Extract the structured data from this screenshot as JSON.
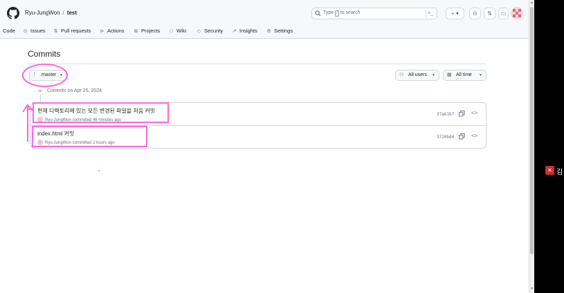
{
  "header": {
    "owner": "Ryu-JungWon",
    "separator": "/",
    "repo": "test",
    "search_placeholder_prefix": "Type",
    "search_key": "/",
    "search_placeholder_suffix": "to search",
    "command_glyph": ">_",
    "new_button": "+ ▾",
    "issues_icon": "⊙",
    "pr_icon": "⇅",
    "inbox_icon": "▭"
  },
  "nav": {
    "items": [
      {
        "label": "Code",
        "icon": "code-icon"
      },
      {
        "label": "Issues",
        "icon": "issue-icon"
      },
      {
        "label": "Pull requests",
        "icon": "pull-request-icon"
      },
      {
        "label": "Actions",
        "icon": "play-icon"
      },
      {
        "label": "Projects",
        "icon": "table-icon"
      },
      {
        "label": "Wiki",
        "icon": "book-icon"
      },
      {
        "label": "Security",
        "icon": "shield-icon"
      },
      {
        "label": "Insights",
        "icon": "graph-icon"
      },
      {
        "label": "Settings",
        "icon": "gear-icon"
      }
    ]
  },
  "page": {
    "title": "Commits",
    "branch": "master",
    "filter_users": "All users",
    "filter_time": "All time"
  },
  "commit_group": {
    "heading": "Commits on Apr 25, 2024",
    "commits": [
      {
        "message": "현재 디렉토리에 있는 모든 변경된 파일을 처음 커밋",
        "author": "Ryu-JungWon",
        "action": "committed",
        "time": "46 minutes ago",
        "sha": "37a61b7"
      },
      {
        "message": "index.html 커밋",
        "author": "Ryu-JungWon",
        "action": "committed",
        "time": "2 hours ago",
        "sha": "3720bd4"
      }
    ]
  },
  "side_panel": {
    "participant": "김"
  },
  "colors": {
    "annotation": "#ff66dd",
    "border": "#d0d7de",
    "muted_text": "#656d76"
  }
}
